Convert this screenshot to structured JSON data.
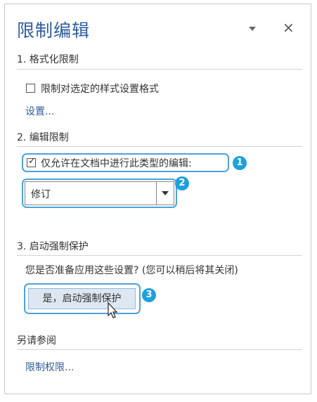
{
  "panel": {
    "title": "限制编辑",
    "close_label": "×"
  },
  "section1": {
    "header": "1. 格式化限制",
    "checkbox_label": "限制对选定的样式设置格式",
    "checkbox_checked": false,
    "settings_link": "设置..."
  },
  "section2": {
    "header": "2. 编辑限制",
    "checkbox_label": "仅允许在文档中进行此类型的编辑:",
    "checkbox_checked": true,
    "select_value": "修订"
  },
  "section3": {
    "header": "3. 启动强制保护",
    "question": "您是否准备应用这些设置? (您可以稍后将其关闭)",
    "button_label": "是，启动强制保护"
  },
  "see_also": {
    "header": "另请参阅",
    "permissions_link": "限制权限..."
  },
  "annotations": {
    "badge1": "1",
    "badge2": "2",
    "badge3": "3",
    "accent_color": "#1ea1db"
  },
  "icons": [
    "dropdown-arrow-icon",
    "close-icon",
    "check-icon",
    "chevron-down-icon",
    "cursor-icon"
  ]
}
